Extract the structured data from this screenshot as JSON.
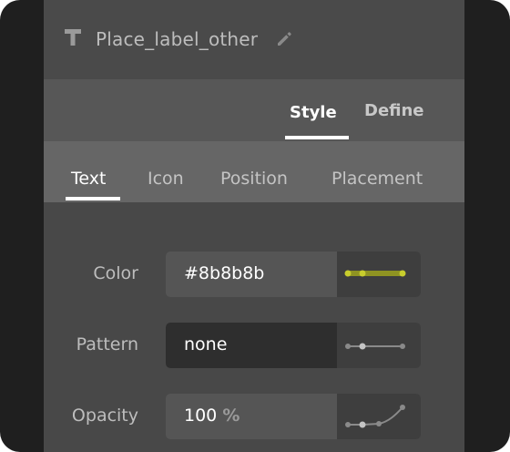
{
  "layer": {
    "title": "Place_label_other",
    "type_icon": "text-icon",
    "edit_icon": "pencil-icon"
  },
  "modes": {
    "style": "Style",
    "define": "Define",
    "active": "Style"
  },
  "subtabs": {
    "text": "Text",
    "icon": "Icon",
    "position": "Position",
    "placement": "Placement",
    "active": "Text"
  },
  "properties": {
    "color": {
      "label": "Color",
      "value": "#8b8b8b",
      "curve_icon": "zoom-curve-icon",
      "curve_accent": "#c8cd2d"
    },
    "pattern": {
      "label": "Pattern",
      "value": "none",
      "curve_icon": "zoom-curve-icon"
    },
    "opacity": {
      "label": "Opacity",
      "value": "100",
      "unit": "%",
      "curve_icon": "zoom-curve-icon"
    }
  },
  "colors": {
    "frame": "#1f1f1f",
    "panel": "#484848",
    "accent": "#c8cd2d"
  }
}
